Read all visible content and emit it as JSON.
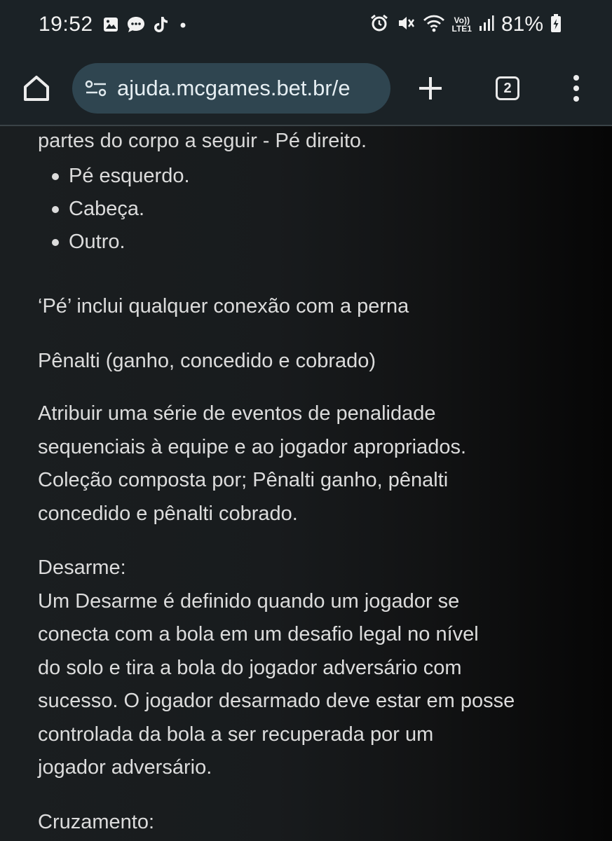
{
  "status_bar": {
    "time": "19:52",
    "battery_text": "81%",
    "network_label_top": "Vo))",
    "network_label_bottom": "LTE1",
    "left_icons": [
      "gallery-icon",
      "messages-icon",
      "tiktok-icon",
      "notification-dot-icon"
    ],
    "right_icons": [
      "alarm-icon",
      "mute-icon",
      "wifi-icon",
      "signal-icon",
      "battery-charging-icon"
    ]
  },
  "toolbar": {
    "url": "ajuda.mcgames.bet.br/e",
    "tab_count": "2"
  },
  "content": {
    "cutoff_line": "partes do corpo a seguir - Pé direito.",
    "bullets": [
      "Pé esquerdo.",
      "Cabeça.",
      "Outro."
    ],
    "para_pe": "‘Pé’ inclui qualquer conexão com a perna",
    "penalti_heading": "Pênalti (ganho, concedido e cobrado)",
    "penalti_body": [
      "Atribuir uma série de eventos de penalidade",
      "sequenciais à equipe e ao jogador apropriados.",
      "Coleção composta por; Pênalti ganho, pênalti",
      "concedido e pênalti cobrado."
    ],
    "desarme_heading": "Desarme:",
    "desarme_body": [
      "Um Desarme é definido quando um jogador se",
      "conecta com a bola em um desafio legal no nível",
      "do solo e tira a bola do jogador adversário com",
      "sucesso. O jogador desarmado deve estar em posse",
      "controlada da bola a ser recuperada por um",
      "jogador adversário."
    ],
    "cruzamento_heading": "Cruzamento:"
  },
  "colors": {
    "chrome_bg": "#1b2226",
    "omnibox_bg": "#2f4550",
    "text": "#dcdcdc"
  }
}
